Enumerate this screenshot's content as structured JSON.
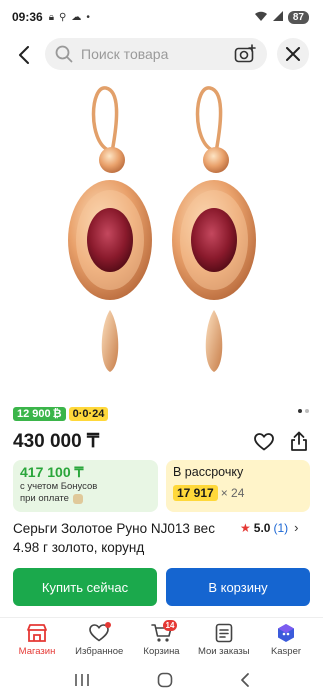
{
  "status_bar": {
    "time": "09:36",
    "battery": "87"
  },
  "search": {
    "placeholder": "Поиск товара"
  },
  "product": {
    "badge_installment_price": "12 900",
    "badge_installment_icon": "₿",
    "badge_plan": "0·0·24",
    "price": "430 000 ₸",
    "bonus_price": "417 100 ₸",
    "bonus_line1": "с учетом Бонусов",
    "bonus_line2": "при оплате",
    "installment_title": "В рассрочку",
    "installment_amount": "17 917",
    "installment_multiplier": "× 24",
    "title": "Серьги Золотое Руно NJ013 вес 4.98 г золото, корунд",
    "rating_value": "5.0",
    "rating_count": "(1)"
  },
  "actions": {
    "buy_now": "Купить сейчас",
    "add_to_cart": "В корзину"
  },
  "bottom_nav": {
    "items": [
      {
        "label": "Магазин",
        "icon": "shop-icon"
      },
      {
        "label": "Избранное",
        "icon": "heart-icon"
      },
      {
        "label": "Корзина",
        "icon": "cart-icon",
        "badge": "14"
      },
      {
        "label": "Мои заказы",
        "icon": "orders-icon"
      },
      {
        "label": "Kasper",
        "icon": "kasper-icon"
      }
    ]
  },
  "colors": {
    "accent_red": "#e53935",
    "buy_green": "#1ba94c",
    "cart_blue": "#1565d0",
    "bonus_green": "#2aa63b",
    "installment_yellow": "#ffd83a"
  }
}
